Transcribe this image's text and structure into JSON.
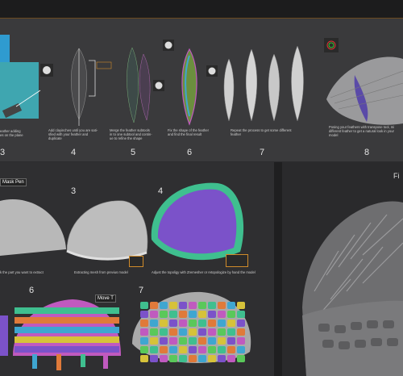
{
  "top_panel": {
    "steps": [
      {
        "num": "3",
        "caption": "eather adding\nes on the plane"
      },
      {
        "num": "4",
        "caption": "Add clayinches until you are sati-\nsfied with your feather and\nduplicate"
      },
      {
        "num": "5",
        "caption": "Merge the feather subtools\nin to one subtool and contin-\nue to refine the shape"
      },
      {
        "num": "6",
        "caption": "Fix the shape of the feather\nand find the final result"
      },
      {
        "num": "7",
        "caption": "Repeat the process to get some different\nfeather"
      },
      {
        "num": "8",
        "caption": "Posing your feathers with transpose tool, mi\ndifferent feather to get a natural look in your\nmodel"
      }
    ]
  },
  "lower_panel": {
    "tool_label_1": "Mask Pen",
    "tool_label_2": "Move T",
    "steps": [
      {
        "num": "3",
        "caption": "Extracting mesh from previus model"
      },
      {
        "num": "4",
        "caption": "Adjust the topoligy with Zremesher or retopologize by hand the model"
      },
      {
        "num": "6",
        "caption": ""
      },
      {
        "num": "7",
        "caption": ""
      }
    ],
    "left_caption": "k the part you want to extract"
  },
  "right_panel": {
    "title": "Fi"
  },
  "colors": {
    "accent": "#d08b2a",
    "teal": "#3fa6b0",
    "purple": "#7b52c9",
    "green": "#3fbf8f"
  }
}
